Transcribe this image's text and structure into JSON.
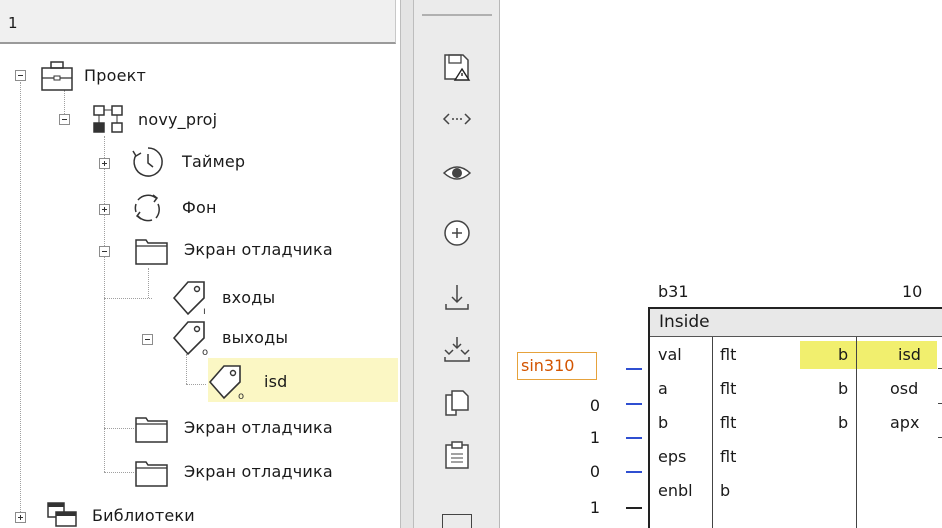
{
  "tree": {
    "header": "1",
    "items": [
      {
        "label": "Проект",
        "icon": "briefcase-icon",
        "expander": "minus"
      },
      {
        "label": "novy_proj",
        "icon": "network-icon",
        "expander": "minus"
      },
      {
        "label": "Таймер",
        "icon": "timer-icon",
        "expander": "plus"
      },
      {
        "label": "Фон",
        "icon": "refresh-cycle-icon",
        "expander": "plus"
      },
      {
        "label": "Экран отладчика",
        "icon": "folder-icon",
        "expander": "minus"
      },
      {
        "label": "входы",
        "icon": "tag-input-icon",
        "subscript": "ı"
      },
      {
        "label": "выходы",
        "icon": "tag-output-icon",
        "subscript": "o",
        "expander": "minus"
      },
      {
        "label": "isd",
        "icon": "tag-output-icon",
        "subscript": "o",
        "selected": true
      },
      {
        "label": "Экран отладчика",
        "icon": "folder-icon"
      },
      {
        "label": "Экран отладчика",
        "icon": "folder-icon"
      },
      {
        "label": "Библиотеки",
        "icon": "library-icon",
        "expander": "plus"
      }
    ]
  },
  "toolbar": {
    "buttons": [
      "save-warning-icon",
      "link-arrows-icon",
      "eye-icon",
      "add-circle-icon",
      "download-icon",
      "merge-down-icon",
      "copy-icon",
      "paste-icon"
    ]
  },
  "diagram": {
    "source_value": "sin310",
    "block": {
      "id_label": "b31",
      "order_label": "10",
      "title": "Inside",
      "inputs": [
        {
          "value": "",
          "name": "val",
          "type": "flt"
        },
        {
          "value": "0",
          "name": "a",
          "type": "flt"
        },
        {
          "value": "1",
          "name": "b",
          "type": "flt"
        },
        {
          "value": "0",
          "name": "eps",
          "type": "flt"
        },
        {
          "value": "1",
          "name": "enbl",
          "type": "b"
        }
      ],
      "outputs": [
        {
          "type": "b",
          "name": "isd",
          "highlighted": true
        },
        {
          "type": "b",
          "name": "osd"
        },
        {
          "type": "b",
          "name": "apx"
        }
      ]
    },
    "colors": {
      "highlight": "#f1ef6e",
      "selection": "#fbf7c4",
      "input_wire": "#2f4fd1",
      "source_text": "#d35400"
    }
  }
}
